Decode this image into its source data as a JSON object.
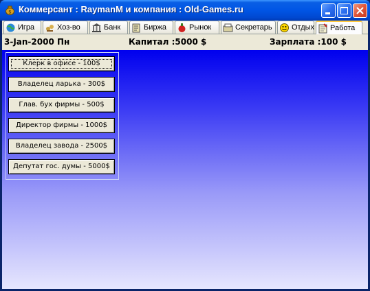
{
  "window": {
    "title": "Коммерсант : RaymanM и компания : Old-Games.ru",
    "icon": "money-bag-icon",
    "controls": [
      "minimize-icon",
      "maximize-icon",
      "close-icon"
    ]
  },
  "tabs": [
    {
      "label": "Игра",
      "icon": "globe-icon"
    },
    {
      "label": "Хоз-во",
      "icon": "farm-icon"
    },
    {
      "label": "Банк",
      "icon": "bank-icon"
    },
    {
      "label": "Биржа",
      "icon": "exchange-icon"
    },
    {
      "label": "Рынок",
      "icon": "market-icon"
    },
    {
      "label": "Секретарь",
      "icon": "secretary-icon"
    },
    {
      "label": "Отдых",
      "icon": "smiley-icon"
    },
    {
      "label": "Работа",
      "icon": "work-icon"
    }
  ],
  "active_tab": "Работа",
  "status": {
    "date": "3-Jan-2000 Пн",
    "capital": "Капитал :5000 $",
    "salary": "Зарплата :100 $"
  },
  "jobs": [
    "Клерк в офисе - 100$",
    "Владелец ларька - 300$",
    "Глав. бух фирмы - 500$",
    "Директор фирмы - 1000$",
    "Владелец завода - 2500$",
    "Депутат гос. думы - 5000$"
  ],
  "colors": {
    "titlebar": "#0055e5",
    "background_top": "#0000ee",
    "background_bottom": "#e6e6fe",
    "active_tab_accent": "#ffc83c"
  }
}
